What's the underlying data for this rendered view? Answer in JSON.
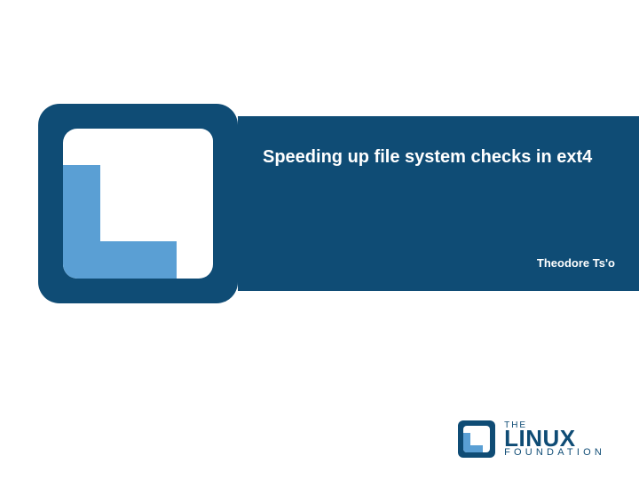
{
  "slide": {
    "title": "Speeding up file system checks in ext4",
    "author": "Theodore Ts'o"
  },
  "footer_logo": {
    "line1": "THE",
    "line2": "LINUX",
    "line3": "FOUNDATION"
  },
  "colors": {
    "dark": "#0f4c75",
    "light": "#5a9fd4",
    "white": "#ffffff"
  }
}
